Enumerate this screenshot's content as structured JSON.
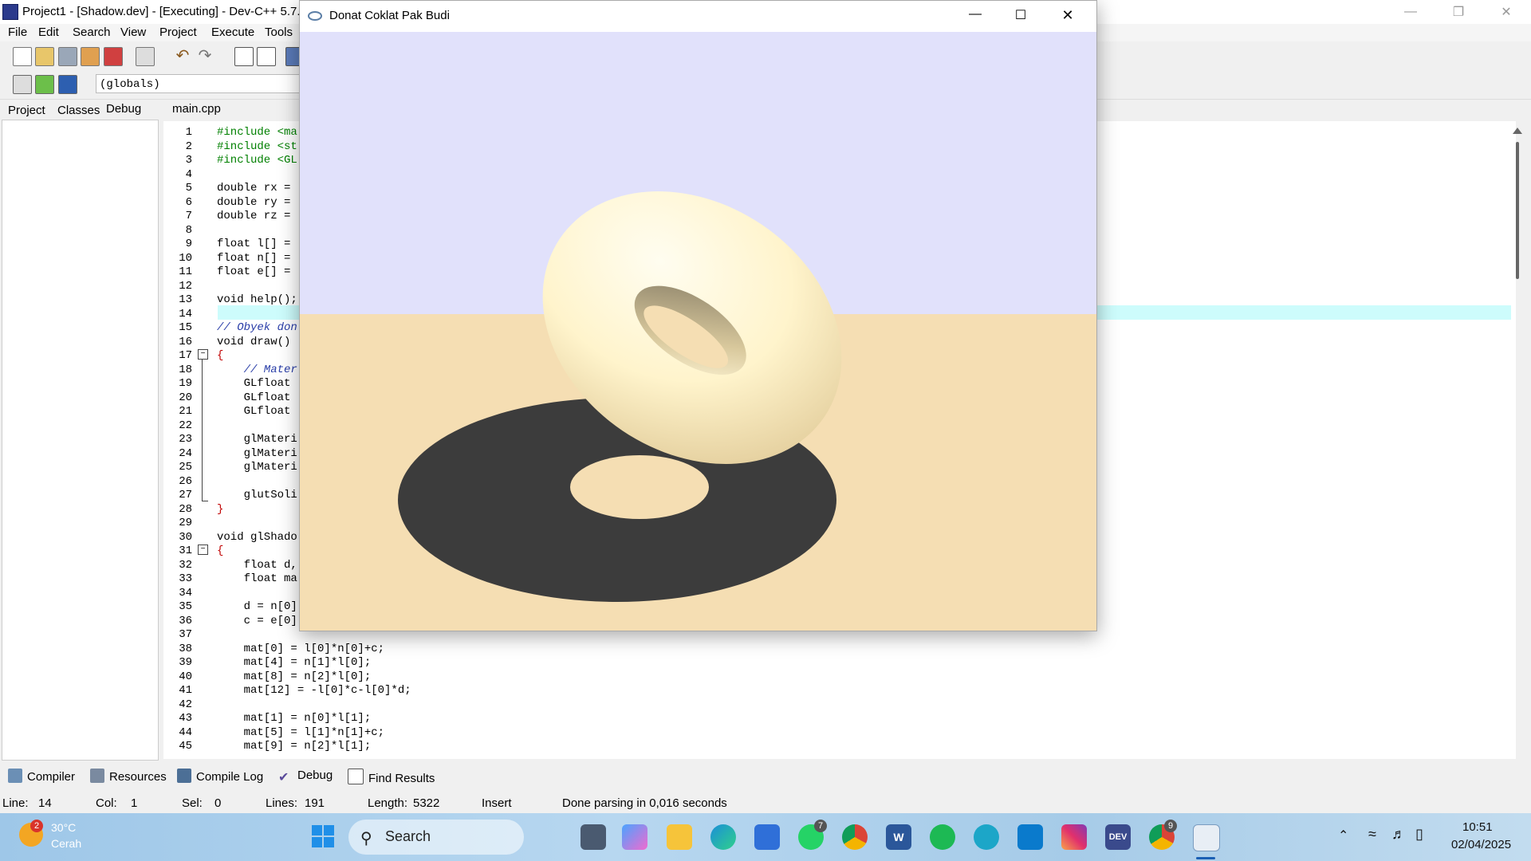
{
  "devcpp": {
    "title": "Project1 - [Shadow.dev] - [Executing] - Dev-C++ 5.7.",
    "menu": [
      "File",
      "Edit",
      "Search",
      "View",
      "Project",
      "Execute",
      "Tools"
    ],
    "globals_value": "(globals)",
    "left_tabs": [
      "Project",
      "Classes",
      "Debug"
    ],
    "editor_tab": "main.cpp",
    "code_lines": [
      {
        "n": "1",
        "t": "#include <ma"
      },
      {
        "n": "2",
        "t": "#include <st"
      },
      {
        "n": "3",
        "t": "#include <GL"
      },
      {
        "n": "4",
        "t": ""
      },
      {
        "n": "5",
        "t": "double rx = "
      },
      {
        "n": "6",
        "t": "double ry = "
      },
      {
        "n": "7",
        "t": "double rz = "
      },
      {
        "n": "8",
        "t": ""
      },
      {
        "n": "9",
        "t": "float l[] = "
      },
      {
        "n": "10",
        "t": "float n[] = "
      },
      {
        "n": "11",
        "t": "float e[] = "
      },
      {
        "n": "12",
        "t": ""
      },
      {
        "n": "13",
        "t": "void help();"
      },
      {
        "n": "14",
        "t": ""
      },
      {
        "n": "15",
        "t": "// Obyek don"
      },
      {
        "n": "16",
        "t": "void draw() "
      },
      {
        "n": "17",
        "t": "{"
      },
      {
        "n": "18",
        "t": "    // Mater"
      },
      {
        "n": "19",
        "t": "    GLfloat "
      },
      {
        "n": "20",
        "t": "    GLfloat "
      },
      {
        "n": "21",
        "t": "    GLfloat "
      },
      {
        "n": "22",
        "t": ""
      },
      {
        "n": "23",
        "t": "    glMateri"
      },
      {
        "n": "24",
        "t": "    glMateri"
      },
      {
        "n": "25",
        "t": "    glMateri"
      },
      {
        "n": "26",
        "t": ""
      },
      {
        "n": "27",
        "t": "    glutSoli"
      },
      {
        "n": "28",
        "t": "}"
      },
      {
        "n": "29",
        "t": ""
      },
      {
        "n": "30",
        "t": "void glShado"
      },
      {
        "n": "31",
        "t": "{"
      },
      {
        "n": "32",
        "t": "    float d,"
      },
      {
        "n": "33",
        "t": "    float ma"
      },
      {
        "n": "34",
        "t": ""
      },
      {
        "n": "35",
        "t": "    d = n[0]"
      },
      {
        "n": "36",
        "t": "    c = e[0]"
      },
      {
        "n": "37",
        "t": ""
      },
      {
        "n": "38",
        "t": "    mat[0] = l[0]*n[0]+c;"
      },
      {
        "n": "39",
        "t": "    mat[4] = n[1]*l[0];"
      },
      {
        "n": "40",
        "t": "    mat[8] = n[2]*l[0];"
      },
      {
        "n": "41",
        "t": "    mat[12] = -l[0]*c-l[0]*d;"
      },
      {
        "n": "42",
        "t": ""
      },
      {
        "n": "43",
        "t": "    mat[1] = n[0]*l[1];"
      },
      {
        "n": "44",
        "t": "    mat[5] = l[1]*n[1]+c;"
      },
      {
        "n": "45",
        "t": "    mat[9] = n[2]*l[1];"
      }
    ],
    "bottom_tabs": [
      "Compiler",
      "Resources",
      "Compile Log",
      "Debug",
      "Find Results"
    ],
    "status": {
      "line_label": "Line:",
      "line_value": "14",
      "col_label": "Col:",
      "col_value": "1",
      "sel_label": "Sel:",
      "sel_value": "0",
      "lines_label": "Lines:",
      "lines_value": "191",
      "length_label": "Length:",
      "length_value": "5322",
      "mode": "Insert",
      "message": "Done parsing in 0,016 seconds"
    }
  },
  "glut_window": {
    "title": "Donat Coklat Pak Budi",
    "colors": {
      "sky": "#e1e1fb",
      "floor": "#f5deb3",
      "shadow": "#3c3c3c",
      "torus": "#fff6d0"
    }
  },
  "taskbar": {
    "weather_temp": "30°C",
    "weather_desc": "Cerah",
    "weather_badge": "2",
    "search_label": "Search",
    "whatsapp_badge": "7",
    "chrome_badge": "9",
    "time": "10:51",
    "date": "02/04/2025"
  }
}
